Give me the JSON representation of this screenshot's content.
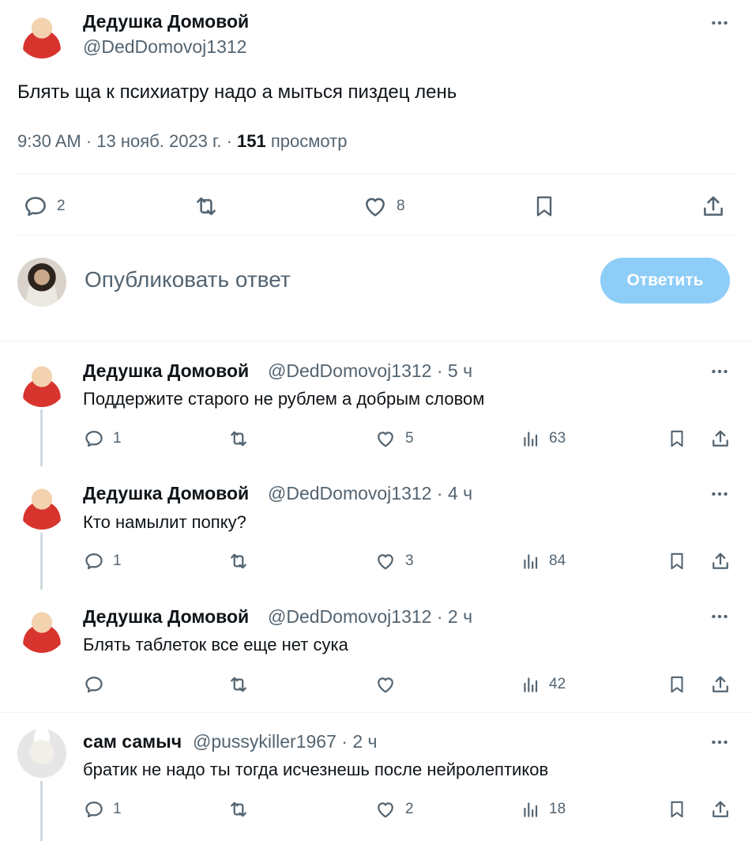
{
  "main_tweet": {
    "author_name": "Дедушка Домовой",
    "author_handle": "@DedDomovoj1312",
    "text": "Блять ща к психиатру надо а мыться пиздец лень",
    "time": "9:30 AM · 13 нояб. 2023 г. · ",
    "views_count": "151",
    "views_label": " просмотр",
    "reply_count": "2",
    "like_count": "8"
  },
  "composer": {
    "placeholder": "Опубликовать ответ",
    "button_label": "Ответить"
  },
  "replies": [
    {
      "author_name": "Дедушка Домовой",
      "meta": "@DedDomovoj1312 · 5 ч",
      "text": "Поддержите старого не рублем а добрым словом",
      "reply_count": "1",
      "like_count": "5",
      "view_count": "63"
    },
    {
      "author_name": "Дедушка Домовой",
      "meta": "@DedDomovoj1312 · 4 ч",
      "text": "Кто намылит попку?",
      "reply_count": "1",
      "like_count": "3",
      "view_count": "84"
    },
    {
      "author_name": "Дедушка Домовой",
      "meta": "@DedDomovoj1312 · 2 ч",
      "text": "Блять таблеток все еще нет сука",
      "reply_count": "",
      "like_count": "",
      "view_count": "42"
    },
    {
      "author_name": "сам самыч",
      "meta": "@pussykiller1967 · 2 ч",
      "text": "братик не надо ты тогда исчезнешь после нейролептиков",
      "reply_count": "1",
      "like_count": "2",
      "view_count": "18"
    }
  ],
  "colors": {
    "text_primary": "#0f1419",
    "text_secondary": "#536471",
    "button_disabled": "#8ecdf8",
    "divider": "#eff3f4"
  }
}
